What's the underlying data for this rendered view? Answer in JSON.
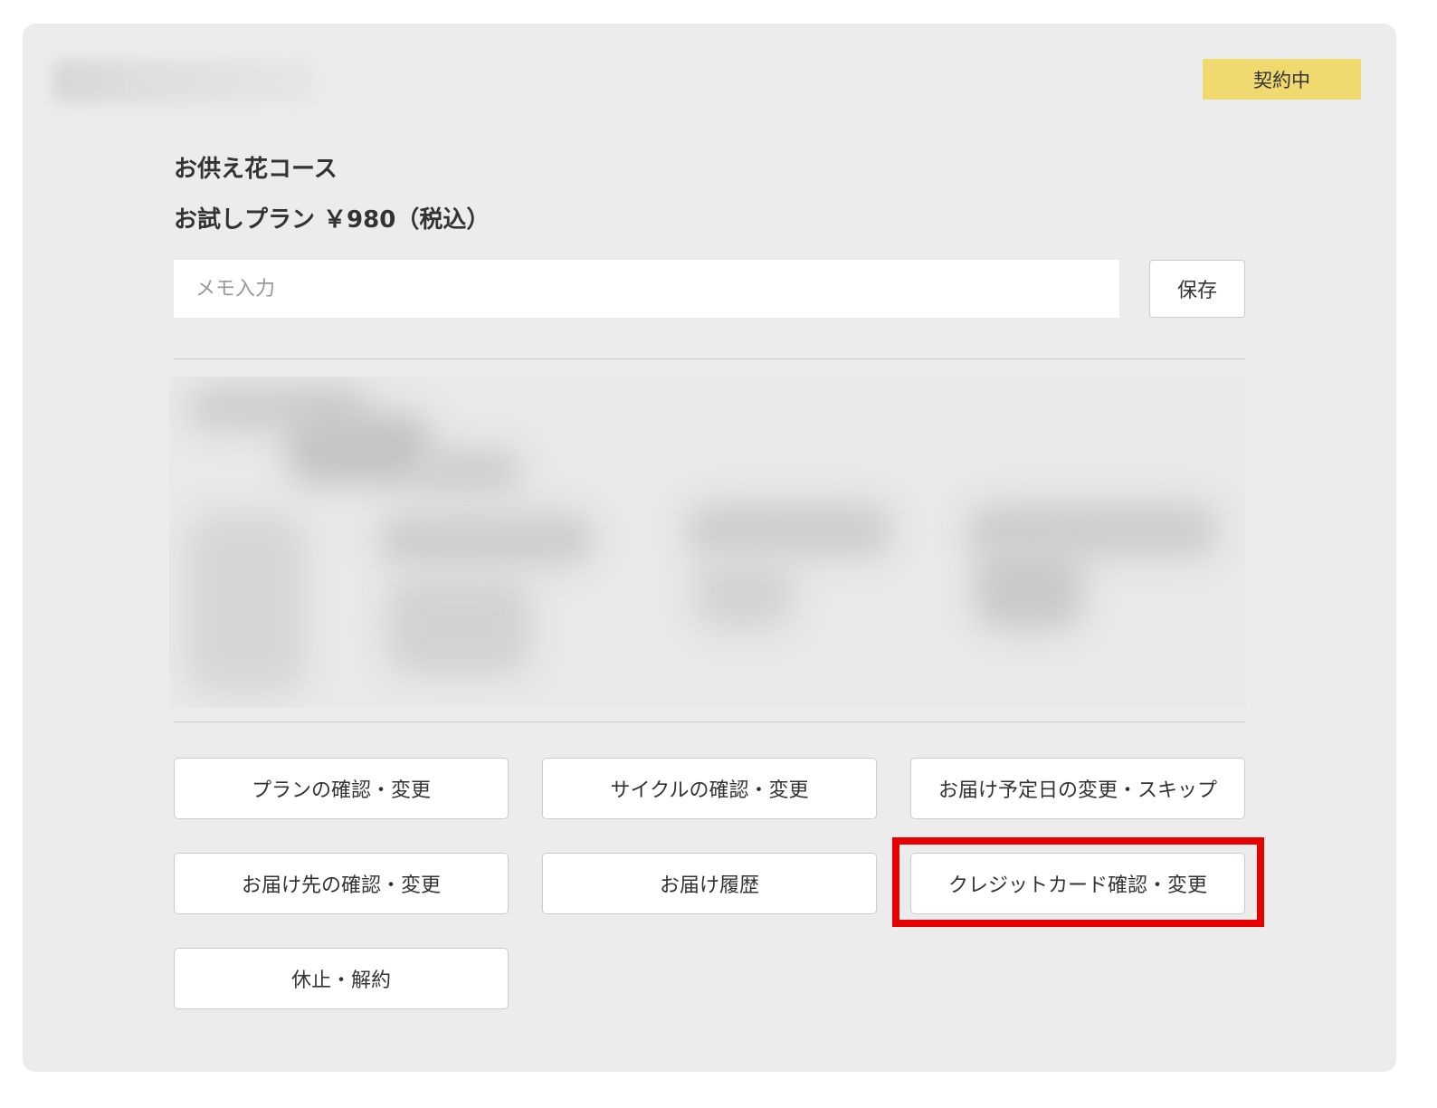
{
  "status_badge": "契約中",
  "course_name": "お供え花コース",
  "plan_price": "お試しプラン ￥980（税込）",
  "memo": {
    "placeholder": "メモ入力",
    "value": "",
    "save_label": "保存"
  },
  "actions": [
    "プランの確認・変更",
    "サイクルの確認・変更",
    "お届け予定日の変更・スキップ",
    "お届け先の確認・変更",
    "お届け履歴",
    "クレジットカード確認・変更",
    "休止・解約"
  ],
  "highlight_color": "#e60000",
  "badge_color": "#f0d96e"
}
